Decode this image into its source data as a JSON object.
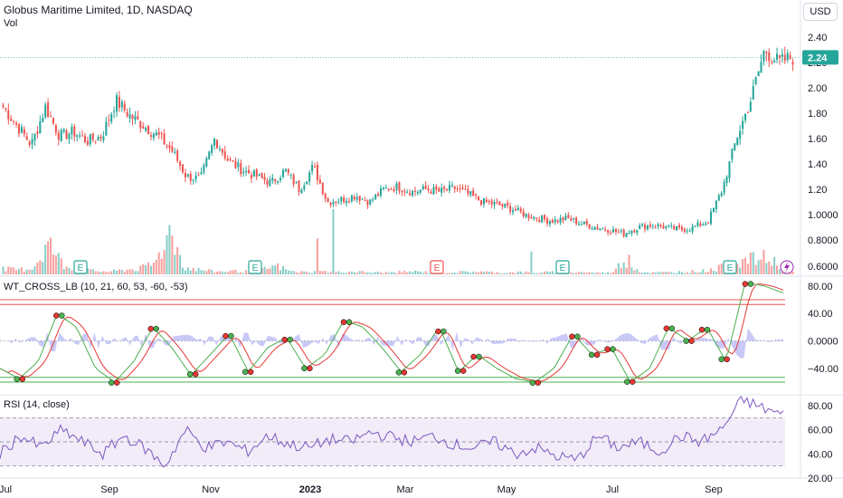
{
  "header": {
    "symbol_title": "Globus Maritime Limited, 1D, NASDAQ",
    "volume_label": "Vol",
    "currency_button": "USD"
  },
  "colors": {
    "up": "#26a69a",
    "down": "#ef5350",
    "wt1": "#4caf50",
    "wt2": "#e53935",
    "histogram": "#9c9cf2",
    "rsi_line": "#7e57c2",
    "rsi_band": "#ede7f6",
    "earnings_green": "#26a69a",
    "earnings_red": "#ef5350",
    "price_badge": "#26a69a"
  },
  "price_axis": {
    "ticks": [
      "2.40",
      "2.20",
      "2.00",
      "1.80",
      "1.60",
      "1.40",
      "1.20",
      "1.0000",
      "0.8000",
      "0.6000"
    ],
    "current_price": "2.24"
  },
  "time_axis": {
    "labels": [
      "Jul",
      "Sep",
      "Nov",
      "2023",
      "Mar",
      "May",
      "Jul",
      "Sep"
    ]
  },
  "earnings_markers": [
    {
      "label": "E",
      "kind": "green"
    },
    {
      "label": "E",
      "kind": "green"
    },
    {
      "label": "E",
      "kind": "red"
    },
    {
      "label": "E",
      "kind": "green"
    },
    {
      "label": "E",
      "kind": "green"
    }
  ],
  "wt_indicator": {
    "title": "WT_CROSS_LB (10, 21, 60, 53, -60, -53)",
    "ticks": [
      "80.00",
      "40.00",
      "0.0000",
      "−40.00"
    ],
    "levels": [
      60,
      53,
      -53,
      -60
    ]
  },
  "rsi_indicator": {
    "title": "RSI (14, close)",
    "ticks": [
      "80.00",
      "60.00",
      "40.00",
      "20.00"
    ],
    "band": [
      30,
      70
    ],
    "middle": 50
  },
  "chart_data": {
    "type": "candlestick",
    "title": "Globus Maritime Limited, 1D, NASDAQ",
    "x_range": [
      "2022-07",
      "2023-10"
    ],
    "price_keypoints": [
      1.85,
      1.7,
      1.55,
      1.85,
      1.62,
      1.65,
      1.58,
      1.62,
      1.9,
      1.78,
      1.7,
      1.62,
      1.5,
      1.3,
      1.28,
      1.6,
      1.42,
      1.35,
      1.3,
      1.25,
      1.35,
      1.2,
      1.38,
      1.1,
      1.12,
      1.15,
      1.1,
      1.2,
      1.22,
      1.18,
      1.2,
      1.18,
      1.21,
      1.16,
      1.1,
      1.08,
      1.05,
      1.0,
      0.97,
      0.95,
      0.97,
      0.93,
      0.9,
      0.88,
      0.85,
      0.9,
      0.92,
      0.9,
      0.88,
      0.9,
      0.95,
      1.2,
      1.6,
      1.9,
      2.3,
      2.2,
      2.24
    ],
    "volume_keypoints": [
      0.1,
      0.08,
      0.12,
      0.55,
      0.15,
      0.1,
      0.06,
      0.05,
      0.08,
      0.1,
      0.2,
      0.75,
      0.12,
      0.08,
      0.05,
      0.06,
      0.05,
      0.08,
      0.15,
      0.05,
      0.04,
      0.05,
      0.04,
      0.05,
      0.04,
      0.03,
      0.04,
      0.05,
      0.04,
      0.03,
      0.04,
      0.05,
      0.04,
      0.03,
      0.04,
      0.03,
      0.04,
      0.03,
      0.04,
      0.03,
      0.03,
      0.25,
      0.04,
      0.03,
      0.04,
      0.05,
      0.06,
      0.1,
      0.2,
      0.25,
      0.3,
      0.2,
      0.1
    ],
    "wt_keypoints": [
      -40,
      -55,
      -30,
      40,
      20,
      -40,
      -60,
      -30,
      20,
      -10,
      -50,
      -20,
      10,
      -45,
      -10,
      5,
      -40,
      -20,
      30,
      20,
      -10,
      -45,
      -20,
      20,
      -45,
      -20,
      -40,
      -55,
      -60,
      -40,
      10,
      -20,
      -10,
      -60,
      -40,
      20,
      0,
      20,
      -30,
      85,
      80,
      70
    ],
    "rsi_keypoints": [
      40,
      55,
      45,
      60,
      50,
      40,
      55,
      45,
      30,
      60,
      45,
      50,
      42,
      55,
      48,
      45,
      52,
      50,
      58,
      54,
      50,
      55,
      48,
      45,
      50,
      40,
      45,
      38,
      35,
      55,
      45,
      50,
      42,
      55,
      50,
      60,
      85,
      78,
      72
    ],
    "ylim": [
      0.55,
      2.5
    ]
  }
}
